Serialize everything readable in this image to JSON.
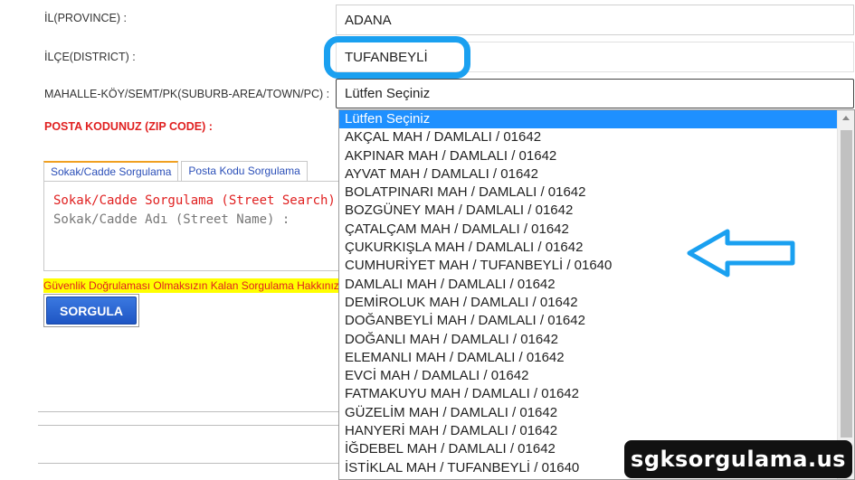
{
  "form": {
    "province_label": "İL(PROVINCE) :",
    "province_value": "ADANA",
    "district_label": "İLÇE(DISTRICT) :",
    "district_value": "TUFANBEYLİ",
    "suburb_label": "MAHALLE-KÖY/SEMT/PK(SUBURB-AREA/TOWN/PC) :",
    "suburb_value": "Lütfen Seçiniz",
    "zip_label": "POSTA KODUNUZ (ZIP CODE) :"
  },
  "tabs": [
    {
      "label": "Sokak/Cadde Sorgulama"
    },
    {
      "label": "Posta Kodu Sorgulama"
    }
  ],
  "panel": {
    "title": "Sokak/Cadde Sorgulama (Street Search)",
    "street_label": "Sokak/Cadde Adı (Street Name) :"
  },
  "warning": "Güvenlik Doğrulaması Olmaksızın Kalan Sorgulama Hakkınız",
  "query_button": "SORGULA",
  "dropdown": {
    "options": [
      "Lütfen Seçiniz",
      "AKÇAL MAH / DAMLALI / 01642",
      "AKPINAR MAH / DAMLALI / 01642",
      "AYVAT MAH / DAMLALI / 01642",
      "BOLATPINARI MAH / DAMLALI / 01642",
      "BOZGÜNEY MAH / DAMLALI / 01642",
      "ÇATALÇAM MAH / DAMLALI / 01642",
      "ÇUKURKIŞLA MAH / DAMLALI / 01642",
      "CUMHURİYET MAH / TUFANBEYLİ / 01640",
      "DAMLALI MAH / DAMLALI / 01642",
      "DEMİROLUK MAH / DAMLALI / 01642",
      "DOĞANBEYLİ MAH / DAMLALI / 01642",
      "DOĞANLI MAH / DAMLALI / 01642",
      "ELEMANLI MAH / DAMLALI / 01642",
      "EVCİ MAH / DAMLALI / 01642",
      "FATMAKUYU MAH / DAMLALI / 01642",
      "GÜZELİM MAH / DAMLALI / 01642",
      "HANYERİ MAH / DAMLALI / 01642",
      "İĞDEBEL MAH / DAMLALI / 01642",
      "İSTİKLAL MAH / TUFANBEYLİ / 01640"
    ]
  },
  "watermark": "sgksorgulama.us",
  "colors": {
    "highlight": "#1aa0f0",
    "selected_option": "#1e90ff",
    "warning_bg": "#ffff00",
    "label_red": "#e02020",
    "button_blue": "#1f56c4"
  }
}
